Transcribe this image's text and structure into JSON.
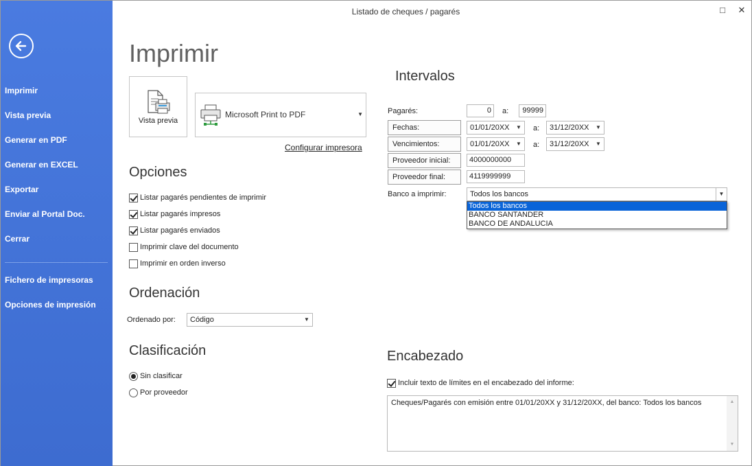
{
  "window": {
    "title": "Listado de cheques / pagarés",
    "maximize_glyph": "□",
    "close_glyph": "✕"
  },
  "sidebar": {
    "back_icon": "back-arrow-icon",
    "items": [
      {
        "label": "Imprimir"
      },
      {
        "label": "Vista previa"
      },
      {
        "label": "Generar en PDF"
      },
      {
        "label": "Generar en EXCEL"
      },
      {
        "label": "Exportar"
      },
      {
        "label": "Enviar al Portal Doc."
      },
      {
        "label": "Cerrar"
      }
    ],
    "items2": [
      {
        "label": "Fichero de impresoras"
      },
      {
        "label": "Opciones de impresión"
      }
    ],
    "bg_color": "#3f6fd1"
  },
  "page": {
    "title": "Imprimir"
  },
  "preview": {
    "label": "Vista previa",
    "icon": "print-preview-icon"
  },
  "printer": {
    "name": "Microsoft Print to PDF",
    "icon": "printer-icon",
    "configure_link": "Configurar impresora"
  },
  "opciones": {
    "heading": "Opciones",
    "checkboxes": [
      {
        "label": "Listar pagarés pendientes de imprimir",
        "checked": true
      },
      {
        "label": "Listar pagarés impresos",
        "checked": true
      },
      {
        "label": "Listar pagarés enviados",
        "checked": true
      },
      {
        "label": "Imprimir clave del documento",
        "checked": false
      },
      {
        "label": "Imprimir en orden inverso",
        "checked": false
      }
    ]
  },
  "ordenacion": {
    "heading": "Ordenación",
    "label": "Ordenado por:",
    "value": "Código"
  },
  "clasificacion": {
    "heading": "Clasificación",
    "radios": [
      {
        "label": "Sin clasificar",
        "selected": true
      },
      {
        "label": "Por proveedor",
        "selected": false
      }
    ]
  },
  "intervalos": {
    "heading": "Intervalos",
    "separator": "a:",
    "pagares": {
      "label": "Pagarés:",
      "from": "0",
      "to": "99999"
    },
    "fechas": {
      "label": "Fechas:",
      "from": "01/01/20XX",
      "to": "31/12/20XX"
    },
    "vencimientos": {
      "label": "Vencimientos:",
      "from": "01/01/20XX",
      "to": "31/12/20XX"
    },
    "proveedor_inicial": {
      "label": "Proveedor inicial:",
      "value": "4000000000"
    },
    "proveedor_final": {
      "label": "Proveedor final:",
      "value": "4119999999"
    },
    "banco": {
      "label": "Banco a imprimir:",
      "value": "Todos los bancos",
      "options": [
        "Todos los bancos",
        "BANCO SANTANDER",
        "BANCO DE ANDALUCIA"
      ],
      "highlight_color": "#0a64d8"
    }
  },
  "encabezado": {
    "heading": "Encabezado",
    "checkbox": {
      "label": "Incluir texto de límites en el encabezado del informe:",
      "checked": true
    },
    "text": "Cheques/Pagarés con emisión entre 01/01/20XX y 31/12/20XX, del banco: Todos los bancos"
  }
}
